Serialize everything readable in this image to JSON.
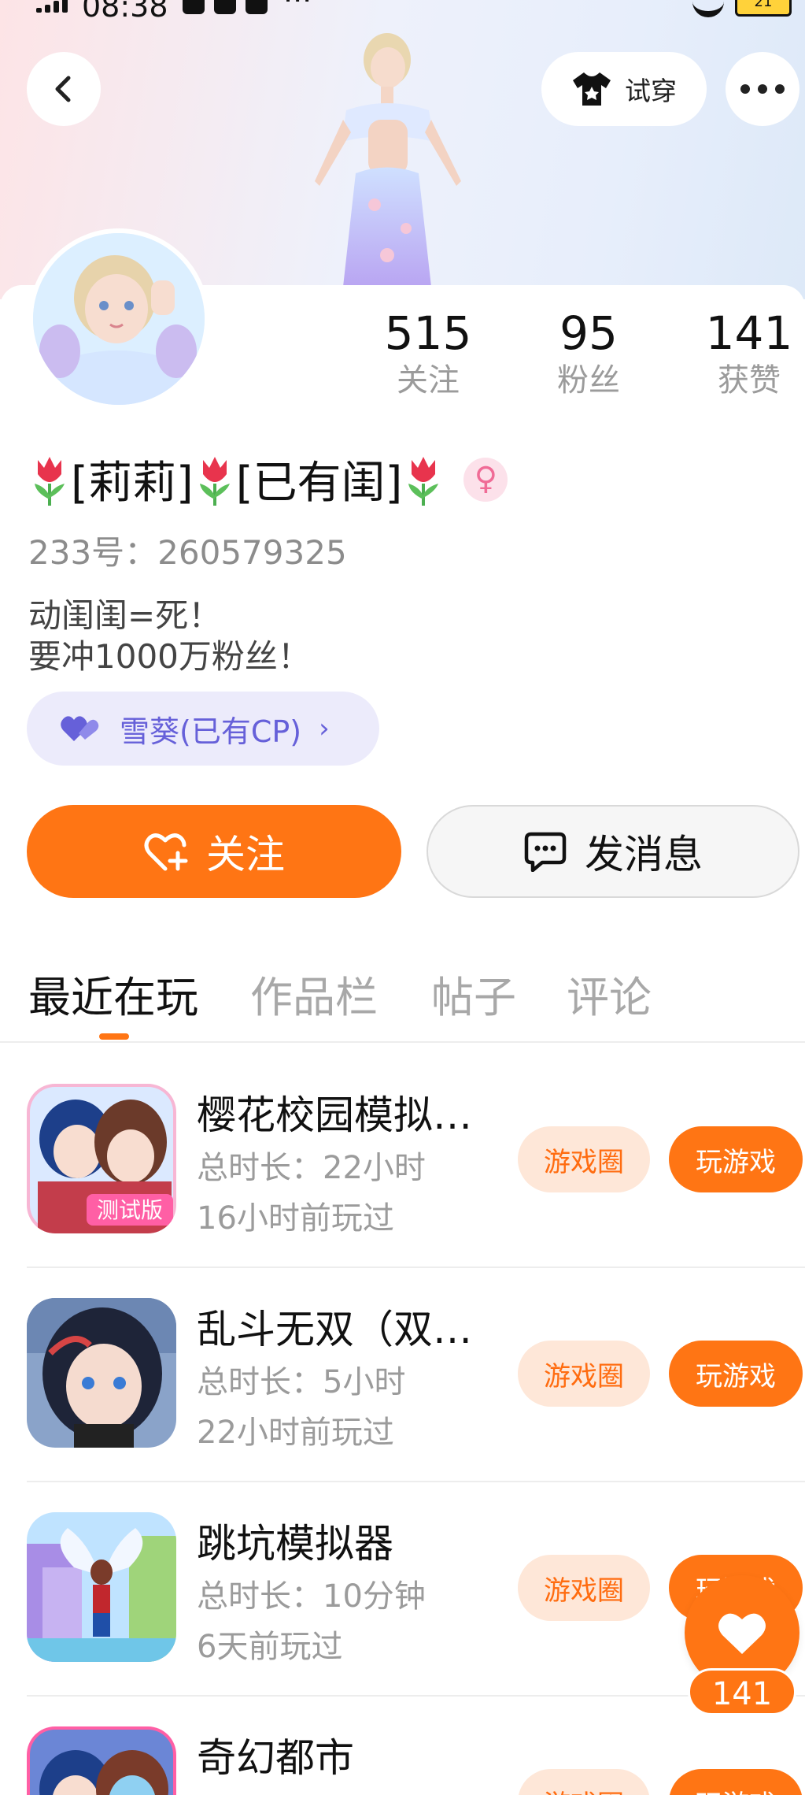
{
  "status_bar": {
    "time": "08:38",
    "more": "···",
    "battery": "21"
  },
  "header": {
    "try_on_label": "试穿"
  },
  "stats": [
    {
      "value": "515",
      "label": "关注"
    },
    {
      "value": "95",
      "label": "粉丝"
    },
    {
      "value": "141",
      "label": "获赞"
    }
  ],
  "profile": {
    "name_part1": "[莉莉]",
    "name_part2": "[已有闺]",
    "gender_symbol": "♀",
    "id_text": "233号：260579325",
    "bio_line1": "动闺闺=死！",
    "bio_line2": "要冲1000万粉丝！",
    "cp_label": "雪葵(已有CP)",
    "cp_chevron": "›"
  },
  "actions": {
    "follow_label": "关注",
    "message_label": "发消息"
  },
  "tabs": [
    {
      "label": "最近在玩",
      "active": true
    },
    {
      "label": "作品栏",
      "active": false
    },
    {
      "label": "帖子",
      "active": false
    },
    {
      "label": "评论",
      "active": false
    }
  ],
  "games": [
    {
      "name": "樱花校园模拟…",
      "duration": "总时长：22小时",
      "last_played": "16小时前玩过",
      "icon_text": "测试版",
      "circle_label": "游戏圈",
      "play_label": "玩游戏"
    },
    {
      "name": "乱斗无双（双…",
      "duration": "总时长：5小时",
      "last_played": "22小时前玩过",
      "circle_label": "游戏圈",
      "play_label": "玩游戏"
    },
    {
      "name": "跳坑模拟器",
      "duration": "总时长：10分钟",
      "last_played": "6天前玩过",
      "circle_label": "游戏圈",
      "play_label": "玩游戏"
    },
    {
      "name": "奇幻都市",
      "circle_label": "游戏圈",
      "play_label": "玩游戏"
    }
  ],
  "like_fab": {
    "count": "141"
  },
  "colors": {
    "accent": "#ff7514",
    "accent_light": "#fee7d8",
    "cp_purple": "#6660d9",
    "cp_bg": "#ecebfb"
  }
}
